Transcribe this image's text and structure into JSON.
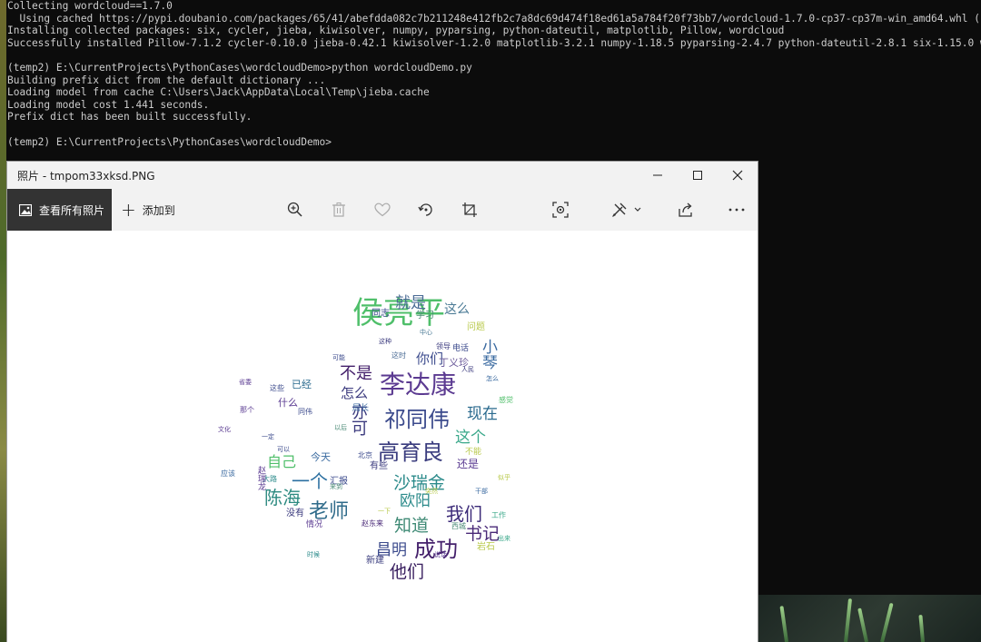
{
  "terminal": {
    "lines": [
      "Collecting wordcloud==1.7.0",
      "  Using cached https://pypi.doubanio.com/packages/65/41/abefdda082c7b211248e412fb2c7a8dc69d474f18ed61a5a784f20f73bb7/wordcloud-1.7.0-cp37-cp37m-win_amd64.whl (",
      "Installing collected packages: six, cycler, jieba, kiwisolver, numpy, pyparsing, python-dateutil, matplotlib, Pillow, wordcloud",
      "Successfully installed Pillow-7.1.2 cycler-0.10.0 jieba-0.42.1 kiwisolver-1.2.0 matplotlib-3.2.1 numpy-1.18.5 pyparsing-2.4.7 python-dateutil-2.8.1 six-1.15.0 w",
      "",
      "(temp2) E:\\CurrentProjects\\PythonCases\\wordcloudDemo>python wordcloudDemo.py",
      "Building prefix dict from the default dictionary ...",
      "Loading model from cache C:\\Users\\Jack\\AppData\\Local\\Temp\\jieba.cache",
      "Loading model cost 1.441 seconds.",
      "Prefix dict has been built successfully.",
      "",
      "(temp2) E:\\CurrentProjects\\PythonCases\\wordcloudDemo>"
    ]
  },
  "photos": {
    "title": "照片 - tmpom33xksd.PNG",
    "see_all_label": "查看所有照片",
    "add_to_label": "添加到",
    "icons": {
      "zoom": "zoom-in-icon",
      "delete": "delete-icon",
      "favorite": "heart-icon",
      "rotate": "rotate-icon",
      "crop": "crop-icon",
      "enhance": "enhance-icon",
      "edit": "edit-draw-icon",
      "share": "share-icon",
      "more": "more-icon"
    }
  },
  "wordcloud": {
    "words": [
      {
        "t": "侯亮平",
        "c": "#4fbf6a"
      },
      {
        "t": "李达康",
        "c": "#5b3a91"
      },
      {
        "t": "祁同伟",
        "c": "#3b4a8c"
      },
      {
        "t": "高育良",
        "c": "#3a3c7e"
      },
      {
        "t": "沙瑞金",
        "c": "#2a8a8a"
      },
      {
        "t": "成功",
        "c": "#44206b"
      },
      {
        "t": "老师",
        "c": "#2f6b8a"
      },
      {
        "t": "陈海",
        "c": "#2c8a80"
      },
      {
        "t": "一个",
        "c": "#2b6fa0"
      },
      {
        "t": "我们",
        "c": "#3b2a78"
      },
      {
        "t": "知道",
        "c": "#3f8a75"
      },
      {
        "t": "书记",
        "c": "#4a2a78"
      },
      {
        "t": "欧阳",
        "c": "#2b8a8a"
      },
      {
        "t": "昌明",
        "c": "#3b4a8c"
      },
      {
        "t": "他们",
        "c": "#3a2060"
      },
      {
        "t": "不是",
        "c": "#44206b"
      },
      {
        "t": "就是",
        "c": "#4a6b95"
      },
      {
        "t": "你们",
        "c": "#3b4a8c"
      },
      {
        "t": "现在",
        "c": "#2a6a8e"
      },
      {
        "t": "这个",
        "c": "#3aa88a"
      },
      {
        "t": "自己",
        "c": "#4fbf6a"
      },
      {
        "t": "怎么",
        "c": "#3b3a7e"
      },
      {
        "t": "这么",
        "c": "#4a7a95"
      },
      {
        "t": "丁义珍",
        "c": "#6b5a9a"
      },
      {
        "t": "小琴",
        "c": "#3a6aa0"
      },
      {
        "t": "亦可",
        "c": "#3b3a7e"
      },
      {
        "t": "还是",
        "c": "#5a3a91"
      },
      {
        "t": "同志",
        "c": "#3b4a8c"
      },
      {
        "t": "学习",
        "c": "#4a8a75"
      },
      {
        "t": "今天",
        "c": "#3a6aa0"
      },
      {
        "t": "没有",
        "c": "#3b3a7e"
      },
      {
        "t": "已经",
        "c": "#2a6a8e"
      },
      {
        "t": "什么",
        "c": "#5a3a91"
      },
      {
        "t": "电话",
        "c": "#3b4a8c"
      },
      {
        "t": "问题",
        "c": "#b8c94a"
      },
      {
        "t": "有些",
        "c": "#3b3a7e"
      },
      {
        "t": "工作",
        "c": "#3aa88a"
      },
      {
        "t": "新建",
        "c": "#3a3c7e"
      },
      {
        "t": "岩石",
        "c": "#b8c94a"
      },
      {
        "t": "情况",
        "c": "#5a3a91"
      },
      {
        "t": "北京",
        "c": "#3b4a8c"
      },
      {
        "t": "局长",
        "c": "#3a6aa0"
      },
      {
        "t": "大路",
        "c": "#2a8a8a"
      },
      {
        "t": "汇报",
        "c": "#3b4a8c"
      },
      {
        "t": "不能",
        "c": "#b8c94a"
      },
      {
        "t": "赵瑞龙",
        "c": "#5a3a91"
      },
      {
        "t": "西城",
        "c": "#4a8a75"
      },
      {
        "t": "领导",
        "c": "#3b3a7e"
      },
      {
        "t": "可以",
        "c": "#3b4a8c"
      },
      {
        "t": "这时",
        "c": "#4a6b95"
      },
      {
        "t": "应该",
        "c": "#3a6aa0"
      },
      {
        "t": "那个",
        "c": "#5a3a91"
      },
      {
        "t": "感觉",
        "c": "#4fbf6a"
      },
      {
        "t": "这些",
        "c": "#3b4a8c"
      },
      {
        "t": "赵东来",
        "c": "#4a2a78"
      },
      {
        "t": "同伟",
        "c": "#3b4a8c"
      },
      {
        "t": "来到",
        "c": "#4a8a75"
      },
      {
        "t": "怎么",
        "c": "#3a6aa0"
      },
      {
        "t": "似乎",
        "c": "#b8c94a"
      },
      {
        "t": "说话",
        "c": "#5a3a91"
      },
      {
        "t": "这种",
        "c": "#3b3a7e"
      },
      {
        "t": "可能",
        "c": "#3b4a8c"
      },
      {
        "t": "中心",
        "c": "#4a7a95"
      },
      {
        "t": "一下",
        "c": "#b8c94a"
      },
      {
        "t": "干部",
        "c": "#3a6aa0"
      },
      {
        "t": "省委",
        "c": "#5a3a91"
      },
      {
        "t": "出来",
        "c": "#3aa88a"
      },
      {
        "t": "以后",
        "c": "#4a8a75"
      },
      {
        "t": "一定",
        "c": "#3b4a8c"
      },
      {
        "t": "突然",
        "c": "#b8c94a"
      },
      {
        "t": "时候",
        "c": "#2a8a8a"
      },
      {
        "t": "文化",
        "c": "#5a3a91"
      },
      {
        "t": "人民",
        "c": "#3b3a7e"
      }
    ]
  }
}
